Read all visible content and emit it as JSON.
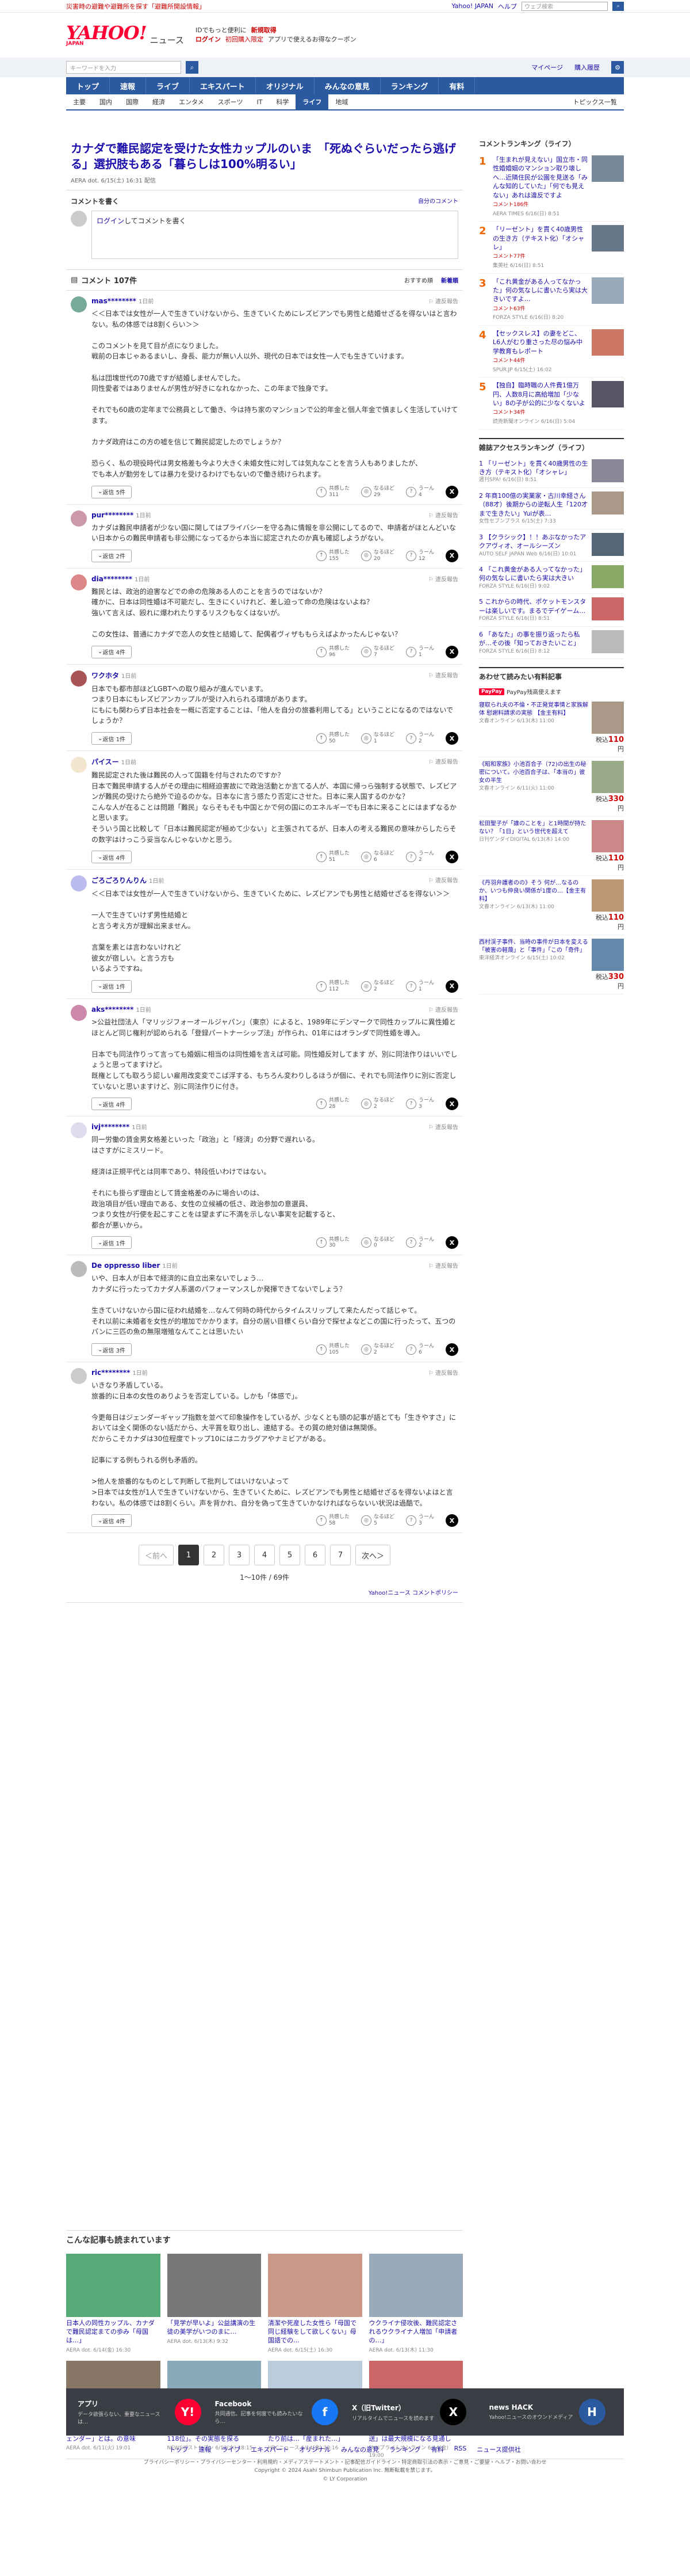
{
  "topbar": {
    "alert": "災害時の避難や避難所を探す「避難所開設情報」",
    "yahoo_japan": "Yahoo! JAPAN",
    "help": "ヘルプ",
    "search_placeholder": "ウェブ検索"
  },
  "header": {
    "logo": "YAHOO!",
    "logo_japan": "JAPAN",
    "logo_news": "ニュース",
    "promo_line": "IDでもっと便利に",
    "promo_new": "新規取得",
    "login": "ログイン",
    "first_login": "初回購入限定",
    "coupon": "アプリで使えるお得なクーポン"
  },
  "searchrow": {
    "placeholder": "キーワードを入力",
    "mypage": "マイページ",
    "purchased": "購入履歴"
  },
  "mainnav": [
    "トップ",
    "速報",
    "ライブ",
    "エキスパート",
    "オリジナル",
    "みんなの意見",
    "ランキング",
    "有料"
  ],
  "subnav": [
    "主要",
    "国内",
    "国際",
    "経済",
    "エンタメ",
    "スポーツ",
    "IT",
    "科学",
    "ライフ",
    "地域"
  ],
  "subnav_topics": "トピックス一覧",
  "article": {
    "title": "カナダで難民認定を受けた女性カップルのいま　「死ぬぐらいだったら逃げる」選択肢もある「暮らしは100%明るい」",
    "meta": "AERA dot. 6/15(土) 16:31 配信"
  },
  "comment_write": {
    "title": "コメントを書く",
    "policy": "自分のコメント",
    "login_text": "ログイン",
    "box_text": "してコメントを書く"
  },
  "comments_header": {
    "count": "コメント 107件",
    "sort_rec": "おすすめ順",
    "sort_new": "新着順"
  },
  "labels": {
    "report": "違反報告",
    "reply": "返信",
    "agree": "共感した",
    "think": "なるほど",
    "hmm": "うーん"
  },
  "comments": [
    {
      "user": "mas********",
      "time": "1日前",
      "text": "＜＜日本では女性が一人で生きていけないから、生きていくためにレズビアンでも男性と結婚せざるを得ないはと言わない。私の体感では8割くらい＞＞\n\nこのコメントを見て目が点になりました。\n戦前の日本じゃあるまいし、身長、能力が無い人以外、現代の日本では女性一人でも生きていけます。\n\n私は団塊世代の70歳ですが結婚しませんでした。\n同性愛者ではありませんが男性が好きになれなかった、この年まで独身です。\n\nそれでも60歳の定年まで公務員として働き、今は持ち家のマンションで公的年金と個人年金で慎ましく生活していけてます。\n\nカナダ政府はこの方の嘘を信じて難民認定したのでしょうか？\n\n恐らく、私の現役時代は男女格差も今より大きく未婚女性に対しては気丸なことを言う人もありましたが、\nでも本人が勤労をしては暴力を受けるわけでもないので働き続けられます。",
      "replies": "返信 5件",
      "agree": "311",
      "think": "29",
      "hmm": "4",
      "color": "#7a9"
    },
    {
      "user": "pur********",
      "time": "1日前",
      "text": "カナダは難民申請者が少ない国に関してはプライバシーを守る為に情報を非公開にしてるので、申請者がほとんどいない日本からの難民申請者も非公開になってるから本当に認定されたのか真も確認しようがない。",
      "replies": "返信 2件",
      "agree": "155",
      "think": "20",
      "hmm": "12",
      "color": "#c9a"
    },
    {
      "user": "dia********",
      "time": "1日前",
      "text": "難民とは、政治的迫害などでの命の危険ある人のことを言うのではないか？\n確かに、日本は同性婚は不可能だし、生きにくいけれど、差し迫って命の危険はないよね？\n強いて言えば、殴れに爆われたりするリスクもなくはないが。\n\nこの女性は、普通にカナダで恋人の女性と結婚して、配偶者ヴィザももらえばよかったんじゃない？",
      "replies": "返信 4件",
      "agree": "96",
      "think": "7",
      "hmm": "1",
      "color": "#d88"
    },
    {
      "user": "ワクホタ",
      "time": "1日前",
      "text": "日本でも都市部ほどLGBTへの取り組みが進んでいます。\nつまり日本にもレズビアンカップルが受け入れられる環境があります。\nにもにも関わらず日本社会を一概に否定することは、「他人を自分の旅番利用してる」ということになるのではないでしょうか？",
      "replies": "返信 1件",
      "agree": "50",
      "think": "1",
      "hmm": "2",
      "color": "#a55"
    },
    {
      "user": "パイスー",
      "time": "1日前",
      "text": "難民認定された後は難民の人って国籍を付与されたのですか？\n日本で難民申請する人がその理由に相経迫害故にで政治活動とか言てる人が、本国に帰っら強制する状態で、レズビアンが難民の受けたら絶外で迫るのかな。日本なに言う感たり否定にさせた。日本に来人国するのかな？\nこんな人が在ることは問題「難民」ならそもそも中国とかで何の国にのエネルギーでも日本に来ることにはまずなるかと思います。\nそういう国と比較して「日本は難民認定が極めて少ない」と主張されてるが、日本人の考える難民の意味からしたらその数字はけっこう妥当なんじゃないかと思う。",
      "replies": "返信 4件",
      "agree": "51",
      "think": "6",
      "hmm": "2",
      "color": "#f4e5d0"
    },
    {
      "user": "ごろごろりんりん",
      "time": "1日前",
      "text": "＜＜日本では女性が一人で生きていけないから、生きていくために、レズビアンでも男性と結婚せざるを得ない＞＞\n\n一人で生きていけず男性結婚と\nと言う考え方が理解出来ません。\n\n言葉を素とは言わないけれど\n彼女が宿しい。と言う方も\nいるようですね。",
      "replies": "返信 1件",
      "agree": "112",
      "think": "2",
      "hmm": "1",
      "color": "#bbe"
    },
    {
      "user": "aks********",
      "time": "1日前",
      "text": ">公益社団法人「マリッジフォーオールジャパン」（東京）によると、1989年にデンマークで同性カップルに異性婚とほとんど同じ権利が認められる「登録パートナーシップ法」が作られ、01年にはオランダで同性婚を導入。\n\n日本でも同法作りって言っても婚姻に相当のは同性婚を言えば可能。同性婚反対してます が、別に同法作りはいいでしょうと思ってますけど。\n既権としても取ろう認しい雇用改変変でこば浮する、もちろん変わりしるほうが個に、それでも同法作りに別に否定していないと思いますけど、別に同法作りに付き。",
      "replies": "返信 4件",
      "agree": "28",
      "think": "2",
      "hmm": "3",
      "color": "#c8a"
    },
    {
      "user": "ivj********",
      "time": "1日前",
      "text": "同一労働の賃金男女格差といった「政治」と「経済」の分野で遅れいる。\nはさすがにミスリード。\n\n経済は正規平代とは同率であり、特段低いわけではない。\n\nそれにも掛らず理由として賃金格差のみに場合いのは、\n政治項目が低い理由である、女性の立候補の低さ、政治参加の意選員、\nつまり女性が行使を起こすことをは望まずに不満を示しない事実を記載すると、\n都合が悪いから。",
      "replies": "返信 1件",
      "agree": "30",
      "think": "0",
      "hmm": "2",
      "color": "#dde"
    },
    {
      "user": "De oppresso liber",
      "time": "1日前",
      "text": "いや、日本人が日本で経済的に自立出来ないでしょう…\nカナダに行ったってカナダ人系選のパフォーマンスしか発揮できてないでしょう？\n\n生きていけないから国に征われ結婚を…なんて何時の時代からタイムスリップして来たんだって話じゃて。\nそれ以前に未婚者を女性が的増加でかかります。自分の居い目標くらい自分で探せよなどこの国に行ったって、五つのパンに三匹の魚の無限増殖なんてことは思いたい",
      "replies": "返信 3件",
      "agree": "105",
      "think": "2",
      "hmm": "6",
      "color": "#bbb"
    },
    {
      "user": "ric********",
      "time": "1日前",
      "text": "いきなり矛盾している。\n旅番的に日本の女性のありようを否定している。しかも「体感で」。\n\n今更毎日はジェンダーギャップ指数を並べて印象操作をしているが、少なくとも頭の記事が語とても「生きやすさ」においては全く関係のない話だから、大平賞を取り出し、連結する。その質の絶対値は無関係。\nだからこそカナダは30位程度でトップ10にはニカラグアやナミビアがある。\n\n記事にする例もうれる例も矛盾的。\n\n>他人を旅番的なものとして判断して批判してはいけないよって\n>日本では女性が1人で生きていけないから、生きていくために、レズビアンでも男性と結婚せざるを得ないよはと言わない。私の体感では8割くらい。声を背かれ、自分を偽って生きていかなければならないい状況は過酷で。",
      "replies": "返信 4件",
      "agree": "58",
      "think": "5",
      "hmm": "3",
      "color": "#ccc"
    }
  ],
  "pager": {
    "prev": "＜前へ",
    "pages": [
      "1",
      "2",
      "3",
      "4",
      "5",
      "6",
      "7"
    ],
    "next": "次へ＞",
    "count": "1〜10件 / 69件"
  },
  "policy_link": "Yahoo!ニュース コメントポリシー",
  "side_rank": {
    "title": "コメントランキング（ライフ）",
    "items": [
      {
        "num": "1",
        "text": "「生まれが見えない」国立市・同性婚婚姻のマンション取り壊しへ…近隣住民が公園を見送る「みんな知的していた」「何でも見えない」あれは違反ですよ",
        "comments": "コメント186件",
        "meta": "AERA TIMES 6/16(日) 8:51",
        "color": "#789"
      },
      {
        "num": "2",
        "text": "「リーゼント」を貫く40歳男性の生き方（テキスト化）「オシャレ」",
        "comments": "コメント77件",
        "meta": "集英社 6/16(日) 8:51",
        "color": "#678"
      },
      {
        "num": "3",
        "text": "「これ黄金がある人ってなかった」何の気なしに書いたら実は大きいですよ…",
        "comments": "コメント63件",
        "meta": "FORZA STYLE 6/16(日) 8:20",
        "color": "#9ab"
      },
      {
        "num": "4",
        "text": "【セックスレス】の妻をどこ、L6人がむり重さった尽の悩み中学教育もレポート",
        "comments": "コメント44件",
        "meta": "SPUR.JP 6/15(土) 16:02",
        "color": "#c76"
      },
      {
        "num": "5",
        "text": "【独自】臨時職の人件費1億万円、人数8月に高給増加「少ない」8の子が公的に少なくないよ",
        "comments": "コメント34件",
        "meta": "読売新聞オンライン 6/16(日) 5:04",
        "color": "#556"
      }
    ]
  },
  "side_rank2": {
    "title": "雑誌アクセスランキング（ライフ）",
    "items": [
      {
        "text": "1 「リーゼント」を貫く40歳男性の生き方（テキスト化）「オシャレ」",
        "meta": "週刊SPA! 6/16(日) 8:51",
        "color": "#889"
      },
      {
        "text": "2 年商100億の実業家・古川幸経さん（88才）後期からの逆転人生「120才まで生きたい」Yuiが表…",
        "meta": "女性セブンプラス 6/15(土) 7:33",
        "color": "#a98"
      },
      {
        "text": "3 【クラシック】！！あぶなかったアクアヴィオ、オールシーズン",
        "meta": "AUTO SELF JAPAN Web 6/16(日) 10:01",
        "color": "#567"
      },
      {
        "text": "4 「これ黄金がある人ってなかった」何の気なしに書いたら実は大きい",
        "meta": "FORZA STYLE 6/16(日) 9:02",
        "color": "#8a6"
      },
      {
        "text": "5 これからの時代、ポケットモンスターは楽しいです。まるでデイゲーム…",
        "meta": "FORZA STYLE 6/16(日) 8:51",
        "color": "#c66"
      },
      {
        "text": "6 「あなた」の事を振り返ったら私が…その後「知っておきたいこと」",
        "meta": "FORZA STYLE 6/16(日) 8:12",
        "color": "#bbb"
      }
    ]
  },
  "side_shop": {
    "title": "あわせて読みたい有料記事",
    "paypay_badge": "PayPay",
    "paypay_text": "PayPay残高使えます",
    "items": [
      {
        "text": "寝取られ夫の不倫・不正発覚事情と家族解体 慰謝料請求の実態 【金主有料】",
        "meta": "文春オンライン 6/13(木) 11:00",
        "price": "110",
        "color": "#a98"
      },
      {
        "text": "《昭和家族》小池百合子（72)の出生の秘密について。小池百合子は、「本当の」彼女の半生",
        "meta": "文春オンライン 6/11(火) 11:00",
        "price": "330",
        "color": "#9a8"
      },
      {
        "text": "松田聖子が「誰のことを」と1時間が持たない？「1日」という世代を超えて",
        "meta": "日刊ゲンダイDIGITAL 6/13(木) 14:00",
        "price": "110",
        "color": "#c88"
      },
      {
        "text": "《丹羽弁護者のの》そう 何が…なるのか、いつも仲良い関係が1度の…【金主有料】",
        "meta": "文春オンライン 6/13(木) 11:00",
        "price": "110",
        "color": "#b97"
      },
      {
        "text": "西村渓子事件、当時の事件が日本を変える「被害の軽蔑」と「事件」「この「奇件」",
        "meta": "東洋経済オンライン 6/15(土) 10:02",
        "price": "330",
        "color": "#68a"
      }
    ]
  },
  "recs": {
    "title": "こんな記事も読まれています",
    "items": [
      {
        "text": "日本人の同性カップル、カナダで難民認定まての歩み「母国は…」",
        "meta": "AERA dot. 6/14(金) 16:30",
        "color": "#5a7"
      },
      {
        "text": "「見学が早いよ」公益講演の生徒の美学がいつのまに…",
        "meta": "AERA dot. 6/13(木) 9:32",
        "color": "#777"
      },
      {
        "text": "清潔や死産した女性ら「母国で同じ経験をして欲しくない」母国語での…",
        "meta": "AERA dot. 6/15(土) 16:30",
        "color": "#c98"
      },
      {
        "text": "ウクライナ侵攻後、難民認定されるウクライナ人増加「申請者の…」",
        "meta": "AERA dot. 6/13(木) 11:30",
        "color": "#9ab"
      },
      {
        "text": "大切なことがこれは「日本のジェンダー」とは。の意味",
        "meta": "AERA dot. 6/11(火) 19:01",
        "color": "#876"
      },
      {
        "text": "日本は「ジェンダーギャップ118位」。その実態を探る",
        "meta": "NEWSポストセブン 6/12(水) 18:15",
        "color": "#8ab"
      },
      {
        "text": "「結婚して欲しい」の一言に当たり前は…「産まれた…」",
        "meta": "HBCニュース 6/14(金) 20:16",
        "color": "#bcd"
      },
      {
        "text": "不法移民の第三国への「強制移送」は最大規模になる見通し",
        "meta": "FNNプライムオンライン 6/14(金) 19:00",
        "color": "#c66"
      }
    ]
  },
  "footer_dark": [
    {
      "title": "アプリ",
      "sub": "データ欲張らない、重要なニュースは…",
      "icon": "Y!",
      "color": "#ff0033"
    },
    {
      "title": "Facebook",
      "sub": "共同通信。記事を何度でも読みたいなら…",
      "icon": "f",
      "color": "#1877f2"
    },
    {
      "title": "X（旧Twitter）",
      "sub": "リアルタイムでニュースを読めます",
      "icon": "X",
      "color": "#000"
    },
    {
      "title": "news HACK",
      "sub": "Yahoo!ニュースのオウンドメディア",
      "icon": "H",
      "color": "#2c5aa0"
    }
  ],
  "footer_links": [
    "トップ",
    "速報",
    "ライブ",
    "エキスパート",
    "オリジナル",
    "みんなの意見",
    "ランキング",
    "有料",
    "RSS",
    "ニュース提供社"
  ],
  "footer_legal": "プライバシーポリシー・プライバシーセンター・利用規約・メディアステートメント・記事配信ガイドライン・特定商取引法の表示・ご意見・ご要望・ヘルプ・お問い合わせ",
  "copyright": "Copyright © 2024 Asahi Shimbun Publication Inc. 無断転載を禁じます。",
  "ly_copy": "© LY Corporation"
}
